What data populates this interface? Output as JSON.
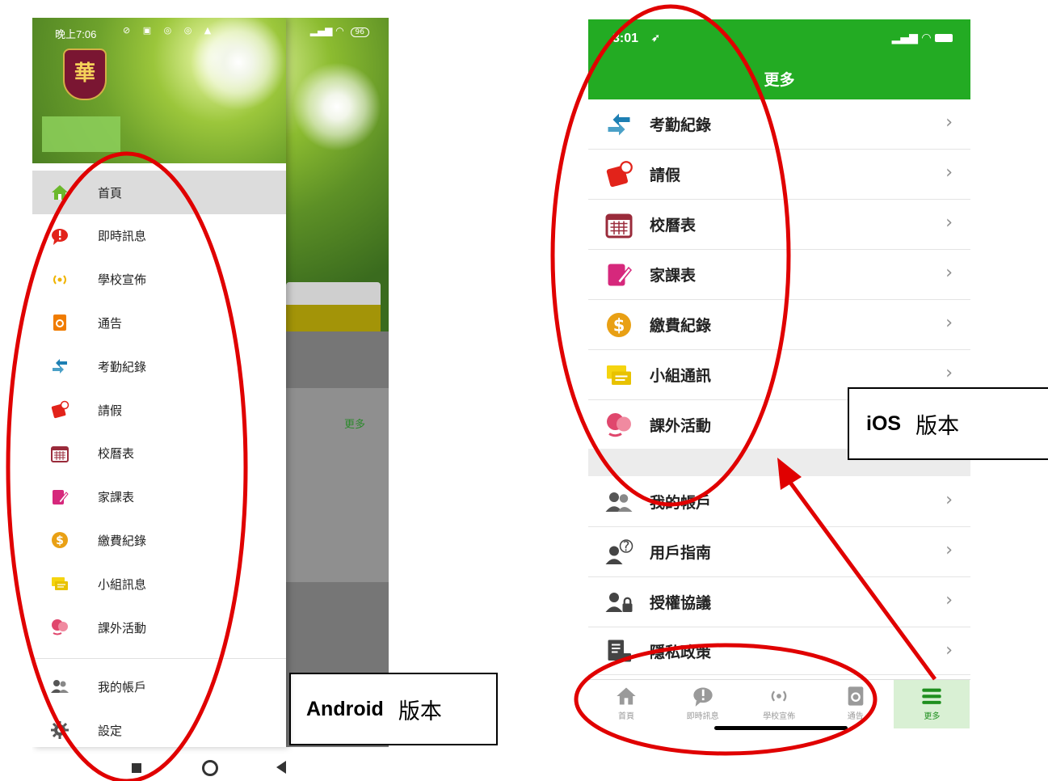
{
  "android": {
    "status": {
      "time": "晚上7:06",
      "battery": "96"
    },
    "drawer_items": [
      {
        "label": "首頁",
        "icon": "home-icon"
      },
      {
        "label": "即時訊息",
        "icon": "message-alert-icon"
      },
      {
        "label": "學校宣佈",
        "icon": "broadcast-icon"
      },
      {
        "label": "通告",
        "icon": "notice-icon"
      },
      {
        "label": "考勤紀錄",
        "icon": "attendance-arrows-icon"
      },
      {
        "label": "請假",
        "icon": "leave-icon"
      },
      {
        "label": "校曆表",
        "icon": "calendar-icon"
      },
      {
        "label": "家課表",
        "icon": "homework-icon"
      },
      {
        "label": "繳費紀錄",
        "icon": "payment-icon"
      },
      {
        "label": "小組訊息",
        "icon": "group-chat-icon"
      },
      {
        "label": "課外活動",
        "icon": "activity-icon"
      }
    ],
    "account_items": [
      {
        "label": "我的帳戶",
        "icon": "account-icon"
      },
      {
        "label": "設定",
        "icon": "gear-icon"
      }
    ],
    "background_more": "更多",
    "logo_char": "華"
  },
  "ios": {
    "status": {
      "time": "3:01"
    },
    "header_title": "更多",
    "group1": [
      {
        "label": "考勤紀錄",
        "icon": "attendance-arrows-icon"
      },
      {
        "label": "請假",
        "icon": "leave-icon"
      },
      {
        "label": "校曆表",
        "icon": "calendar-icon"
      },
      {
        "label": "家課表",
        "icon": "homework-icon"
      },
      {
        "label": "繳費紀錄",
        "icon": "payment-icon"
      },
      {
        "label": "小組通訊",
        "icon": "group-chat-icon"
      },
      {
        "label": "課外活動",
        "icon": "activity-icon"
      }
    ],
    "group2": [
      {
        "label": "我的帳戶",
        "icon": "account-icon"
      },
      {
        "label": "用戶指南",
        "icon": "user-guide-icon"
      },
      {
        "label": "授權協議",
        "icon": "license-icon"
      },
      {
        "label": "隱私政策",
        "icon": "privacy-icon"
      }
    ],
    "tabs": [
      {
        "label": "首頁",
        "icon": "home-icon"
      },
      {
        "label": "即時訊息",
        "icon": "message-alert-icon"
      },
      {
        "label": "學校宣佈",
        "icon": "broadcast-icon"
      },
      {
        "label": "通告",
        "icon": "notice-icon"
      },
      {
        "label": "更多",
        "icon": "menu-icon",
        "active": true
      }
    ]
  },
  "labels": {
    "android_bold": "Android",
    "android_text": "版本",
    "ios_bold": "iOS",
    "ios_text": "版本"
  },
  "colors": {
    "ios_green": "#23ab23",
    "annotation_red": "#e00000"
  }
}
